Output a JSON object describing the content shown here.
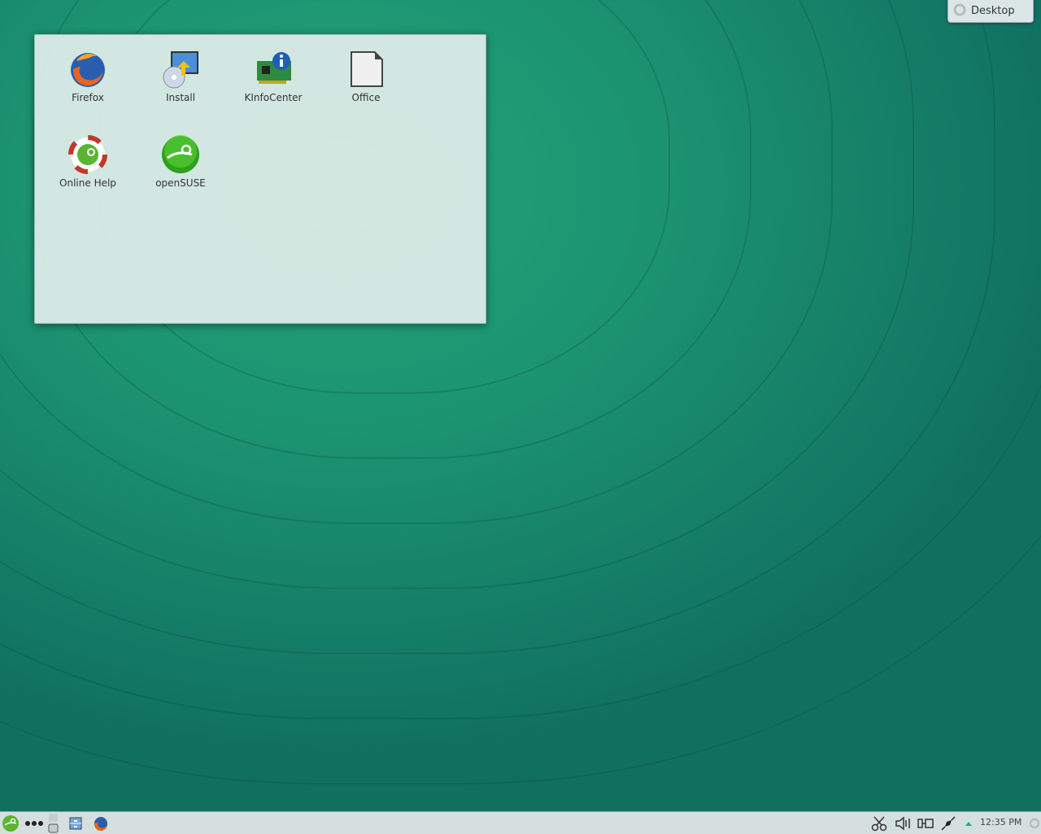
{
  "desktop": {
    "toolbox_label": "Desktop",
    "folder_view": {
      "items": [
        {
          "label": "Firefox",
          "icon": "firefox-icon"
        },
        {
          "label": "Install",
          "icon": "install-icon"
        },
        {
          "label": "KInfoCenter",
          "icon": "kinfocenter-icon"
        },
        {
          "label": "Office",
          "icon": "office-document-icon"
        },
        {
          "label": "Online Help",
          "icon": "help-lifebuoy-icon"
        },
        {
          "label": "openSUSE",
          "icon": "opensuse-icon"
        }
      ]
    }
  },
  "taskbar": {
    "launcher_icon": "opensuse-launcher-icon",
    "clock": "12:35 PM"
  },
  "colors": {
    "accent": "#1c9572",
    "panel": "#d5dfdd"
  }
}
